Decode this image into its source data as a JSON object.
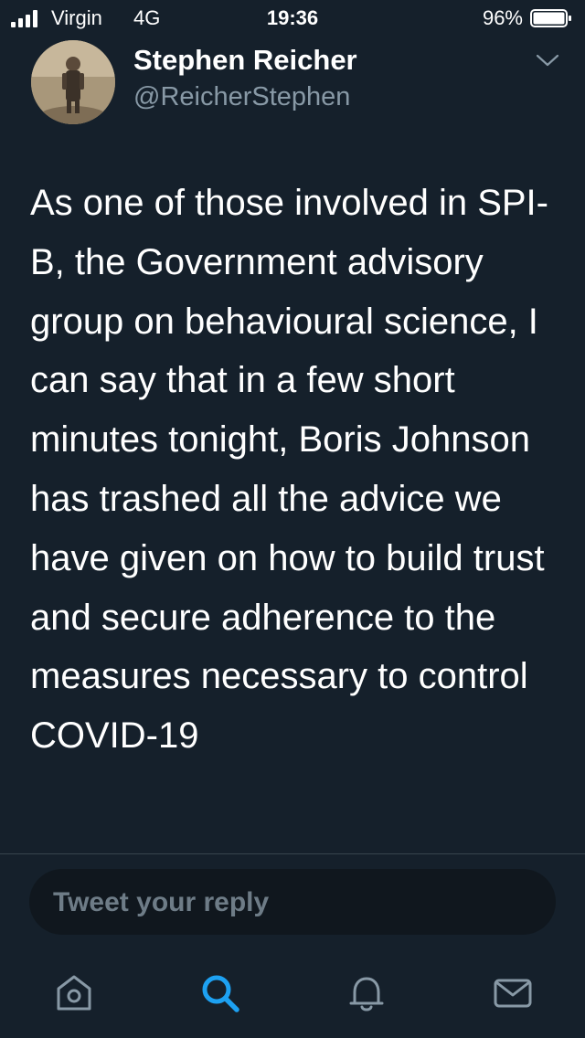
{
  "status_bar": {
    "carrier": "Virgin",
    "network": "4G",
    "time": "19:36",
    "battery_percent": "96%",
    "signal_bars": 4,
    "battery_level": 0.96
  },
  "tweet": {
    "author_name": "Stephen Reicher",
    "author_handle": "@ReicherStephen",
    "text": "As one of those involved in SPI-B, the Government advisory group on behavioural science, I can say that in a few short minutes tonight, Boris Johnson has trashed all the advice we have given on how to build trust and secure adherence to the measures necessary to control COVID-19"
  },
  "reply": {
    "placeholder": "Tweet your reply"
  },
  "tab_bar": {
    "icons": [
      "home-icon",
      "search-icon",
      "notifications-icon",
      "messages-icon"
    ],
    "active": "search-icon"
  },
  "colors": {
    "background": "#15202b",
    "text": "#ffffff",
    "secondary_text": "#8899a6",
    "accent": "#1da1f2",
    "reply_background": "#10171e",
    "divider": "#38444d"
  }
}
